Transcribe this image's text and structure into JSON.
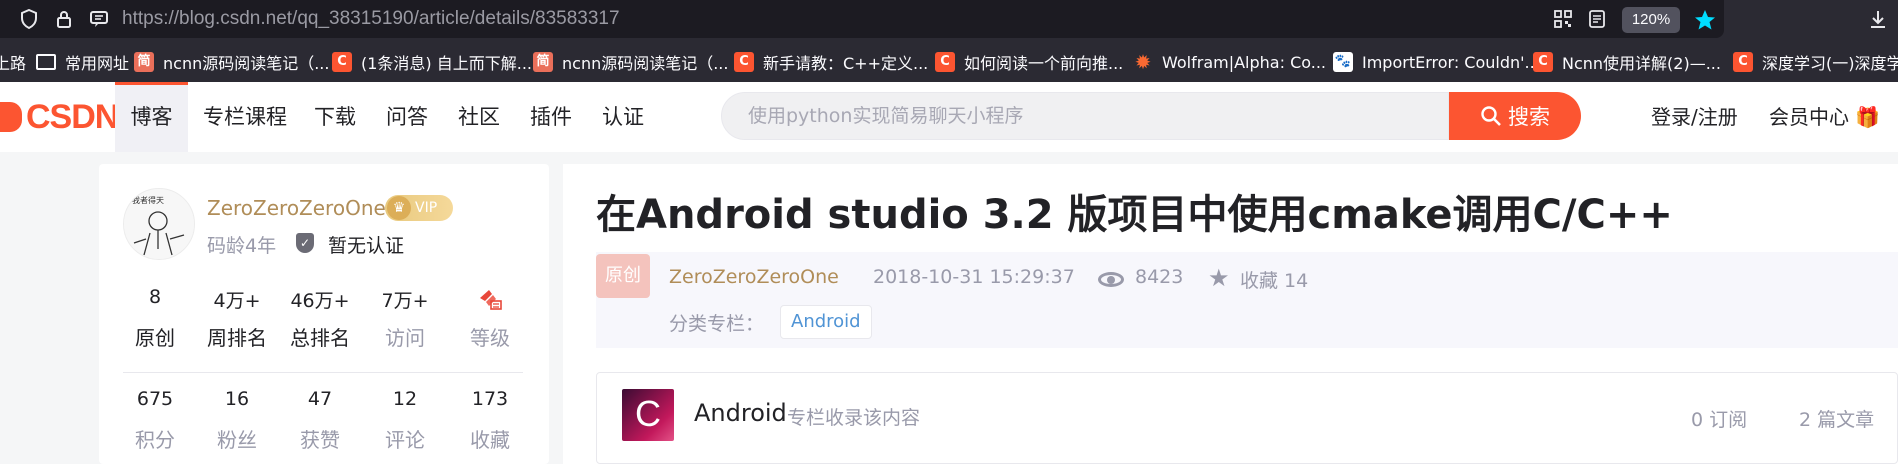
{
  "browser": {
    "url": "https://blog.csdn.net/qq_38315190/article/details/83583317",
    "zoom": "120%"
  },
  "bookmarks": [
    {
      "label": "上路",
      "icon": "none-icon"
    },
    {
      "label": "常用网址",
      "icon": "folder-icon"
    },
    {
      "label": "ncnn源码阅读笔记（...",
      "icon": "jianshu-icon"
    },
    {
      "label": "(1条消息) 自上而下解...",
      "icon": "csdn-icon"
    },
    {
      "label": "ncnn源码阅读笔记（...",
      "icon": "jianshu-icon"
    },
    {
      "label": "新手请教：C++定义...",
      "icon": "csdn-icon"
    },
    {
      "label": "如何阅读一个前向推...",
      "icon": "csdn-icon"
    },
    {
      "label": "Wolfram|Alpha: Co...",
      "icon": "wolfram-icon"
    },
    {
      "label": "ImportError: Couldn'...",
      "icon": "baidu-icon"
    },
    {
      "label": "Ncnn使用详解(2)—...",
      "icon": "csdn-icon"
    },
    {
      "label": "深度学习(一)深度学习...",
      "icon": "csdn-icon"
    }
  ],
  "header": {
    "logo": "CSDN",
    "nav": [
      "博客",
      "专栏课程",
      "下载",
      "问答",
      "社区",
      "插件",
      "认证"
    ],
    "search_placeholder": "使用python实现简易聊天小程序",
    "search_button": "搜索",
    "login": "登录/注册",
    "vip_center": "会员中心",
    "accent": "#fc5531"
  },
  "profile": {
    "name": "ZeroZeroZeroOne",
    "vip": "VIP",
    "code_age": "码龄4年",
    "cert": "暂无认证",
    "stats_row1": [
      {
        "value": "8",
        "label": "原创"
      },
      {
        "value": "4万+",
        "label": "周排名"
      },
      {
        "value": "46万+",
        "label": "总排名"
      },
      {
        "value": "7万+",
        "label": "访问"
      },
      {
        "value": "",
        "label": "等级"
      }
    ],
    "stats_row2": [
      {
        "value": "675",
        "label": "积分"
      },
      {
        "value": "16",
        "label": "粉丝"
      },
      {
        "value": "47",
        "label": "获赞"
      },
      {
        "value": "12",
        "label": "评论"
      },
      {
        "value": "173",
        "label": "收藏"
      }
    ]
  },
  "article": {
    "title": "在Android studio 3.2 版项目中使用cmake调用C/C++",
    "type_badge": "原创",
    "author": "ZeroZeroZeroOne",
    "time": "2018-10-31 15:29:37",
    "views": "8423",
    "collect": "收藏 14",
    "category_label": "分类专栏：",
    "category": "Android"
  },
  "column": {
    "thumb_letter": "C",
    "name": "Android",
    "desc": "专栏收录该内容",
    "subs": "0 订阅",
    "count": "2 篇文章"
  }
}
